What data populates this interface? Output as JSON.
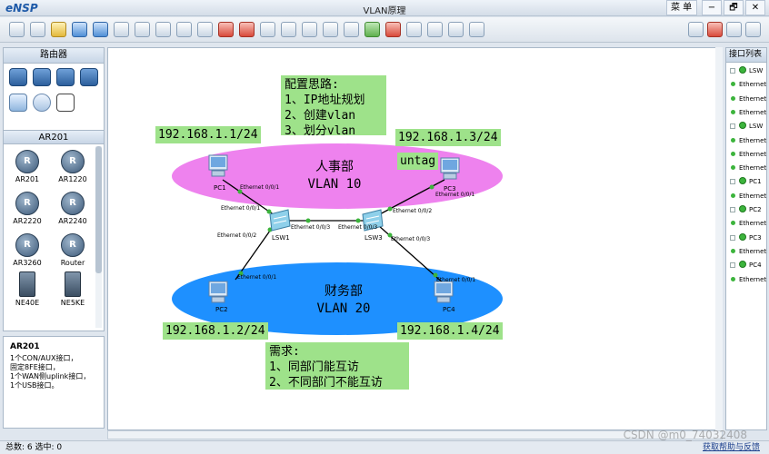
{
  "window": {
    "logo": "eNSP",
    "title": "VLAN原理",
    "menu_label": "菜 单▾",
    "minimize": "−",
    "restore": "🗗",
    "close": "✕"
  },
  "toolbar_icons": [
    "new-icon",
    "new-example-icon",
    "open-icon",
    "save-icon",
    "save-as-icon",
    "print-icon",
    "undo-icon",
    "redo-icon",
    "select-icon",
    "hand-icon",
    "delete-icon",
    "delete-connection-icon",
    "text-icon",
    "palette-icon",
    "zoom-in-icon",
    "zoom-out-icon",
    "reset-zoom-icon",
    "start-device-icon",
    "stop-device-icon",
    "capture-icon",
    "settings-icon",
    "display-grid-icon",
    "terminal-icon",
    "chat-icon",
    "huawei-icon",
    "options-icon",
    "help-icon"
  ],
  "palette": {
    "title": "路由器",
    "section": "AR201",
    "devices": [
      {
        "label": "AR201",
        "icon": "R"
      },
      {
        "label": "AR1220",
        "icon": "R"
      },
      {
        "label": "AR2220",
        "icon": "R"
      },
      {
        "label": "AR2240",
        "icon": "R"
      },
      {
        "label": "AR3260",
        "icon": "R"
      },
      {
        "label": "Router",
        "icon": "R"
      },
      {
        "label": "NE40E",
        "icon": ""
      },
      {
        "label": "NE5KE",
        "icon": ""
      }
    ]
  },
  "description": {
    "title": "AR201",
    "lines": [
      "1个CON/AUX接口，",
      "固定8FE接口，",
      "1个WAN侧uplink接口，",
      "1个USB接口。"
    ]
  },
  "canvas": {
    "note_title": "配置思路:",
    "note_lines": [
      "1、IP地址规划",
      "2、创建vlan",
      "3、划分vlan"
    ],
    "ip_pc1": "192.168.1.1/24",
    "ip_pc3": "192.168.1.3/24",
    "ip_pc2": "192.168.1.2/24",
    "ip_pc4": "192.168.1.4/24",
    "untag": "untag",
    "zone_hr_name": "人事部",
    "zone_hr_vlan": "VLAN 10",
    "zone_fin_name": "财务部",
    "zone_fin_vlan": "VLAN 20",
    "req_title": "需求:",
    "req_lines": [
      "1、同部门能互访",
      "2、不同部门不能互访"
    ],
    "nodes": {
      "pc1": "PC1",
      "pc2": "PC2",
      "pc3": "PC3",
      "pc4": "PC4",
      "lsw1": "LSW1",
      "lsw3": "LSW3"
    },
    "ports": {
      "pc1_e": "Ethernet 0/0/1",
      "lsw1_p1": "Ethernet 0/0/1",
      "lsw1_p2": "Ethernet 0/0/2",
      "lsw1_p3": "Ethernet 0/0/3",
      "lsw3_p3": "Ethernet 0/0/3",
      "lsw3_p2": "Ethernet 0/0/2",
      "lsw3_p3b": "Ethernet 0/0/3",
      "pc3_e": "Ethernet 0/0/1",
      "pc2_e": "Ethernet 0/0/1",
      "pc4_e": "Ethernet 0/0/1"
    },
    "colors": {
      "hr_zone": "#ee82ee",
      "fin_zone": "#1e90ff",
      "note_bg": "#9ee28a"
    }
  },
  "right_panel": {
    "title": "接口列表",
    "rows": [
      {
        "kind": "device",
        "label": "LSW"
      },
      {
        "kind": "port",
        "label": "Ethernet"
      },
      {
        "kind": "port",
        "label": "Ethernet"
      },
      {
        "kind": "port",
        "label": "Ethernet"
      },
      {
        "kind": "device",
        "label": "LSW"
      },
      {
        "kind": "port",
        "label": "Ethernet"
      },
      {
        "kind": "port",
        "label": "Ethernet"
      },
      {
        "kind": "port",
        "label": "Ethernet"
      },
      {
        "kind": "device",
        "label": "PC1"
      },
      {
        "kind": "port",
        "label": "Ethernet"
      },
      {
        "kind": "device",
        "label": "PC2"
      },
      {
        "kind": "port",
        "label": "Ethernet"
      },
      {
        "kind": "device",
        "label": "PC3"
      },
      {
        "kind": "port",
        "label": "Ethernet"
      },
      {
        "kind": "device",
        "label": "PC4"
      },
      {
        "kind": "port",
        "label": "Ethernet"
      }
    ]
  },
  "statusbar": {
    "text": "总数: 6  选中: 0",
    "feedback": "获取帮助与反馈",
    "watermark": "CSDN @m0_74032408"
  }
}
